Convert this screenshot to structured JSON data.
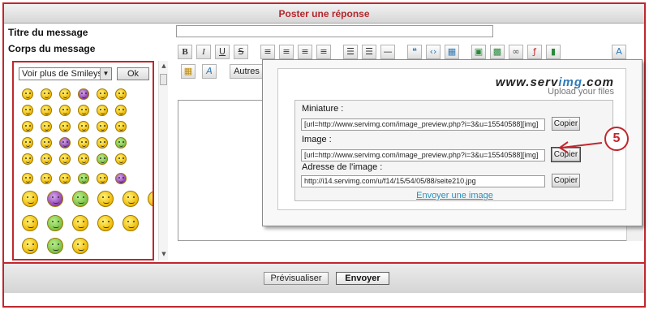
{
  "header": {
    "title": "Poster une réponse"
  },
  "form": {
    "title_label": "Titre du message",
    "body_label": "Corps du message",
    "title_value": ""
  },
  "smileys": {
    "select_value": "Voir plus de Smileys",
    "ok_label": "Ok",
    "count": 50
  },
  "toolbar": {
    "bold": "B",
    "italic": "I",
    "underline": "U",
    "strike": "S",
    "more": "Autres",
    "font_a": "A"
  },
  "popup": {
    "logo_name_a": "www.serv",
    "logo_name_b": "img",
    "logo_name_c": ".com",
    "logo_tagline": "Upload your files",
    "miniature_label": "Miniature :",
    "miniature_value": "[url=http://www.servimg.com/image_preview.php?i=3&u=15540588][img]",
    "image_label": "Image :",
    "image_value": "[url=http://www.servimg.com/image_preview.php?i=3&u=15540588][img]",
    "address_label": "Adresse de l'image :",
    "address_value": "http://i14.servimg.com/u/f14/15/54/05/88/seite210.jpg",
    "copy_label": "Copier",
    "send_image_link": "Envoyer une image"
  },
  "annotation": {
    "number": "5",
    "color": "#c0272d"
  },
  "footer": {
    "preview_label": "Prévisualiser",
    "send_label": "Envoyer"
  },
  "colors": {
    "accent": "#c0272d",
    "link": "#2a8fb8"
  }
}
